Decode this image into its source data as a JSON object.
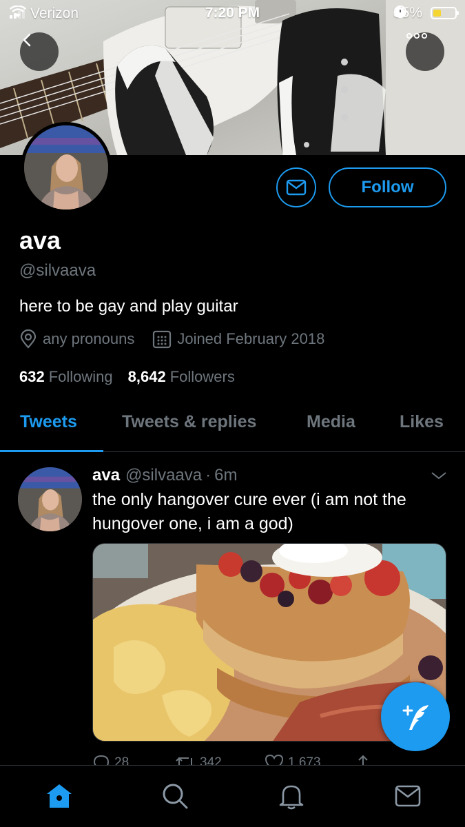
{
  "status_bar": {
    "carrier": "Verizon",
    "time": "7:20 PM",
    "battery_percent_label": "35%",
    "battery_level": 0.35,
    "battery_color": "#f5d531"
  },
  "header": {
    "back_icon": "chevron-left-icon",
    "more_icon": "more-horizontal-icon"
  },
  "profile": {
    "display_name": "ava",
    "handle": "@silvaava",
    "bio": "here to be gay and play guitar",
    "pronouns": "any pronouns",
    "joined": "Joined February 2018",
    "following_count": "632",
    "following_label": "Following",
    "followers_count": "8,642",
    "followers_label": "Followers",
    "follow_label": "Follow",
    "accent_color": "#1d9bf0"
  },
  "tabs": [
    {
      "label": "Tweets",
      "active": true
    },
    {
      "label": "Tweets & replies",
      "active": false
    },
    {
      "label": "Media",
      "active": false
    },
    {
      "label": "Likes",
      "active": false
    }
  ],
  "tweet": {
    "name": "ava",
    "handle": "@silvaava",
    "separator": "·",
    "time": "6m",
    "text": "the only hangover cure ever (i am not the hungover one, i am a god)",
    "replies": "28",
    "retweets": "342",
    "likes": "1,673"
  },
  "bottom_nav": {
    "items": [
      "home-icon",
      "search-icon",
      "notifications-icon",
      "messages-icon"
    ],
    "active": "home-icon"
  }
}
